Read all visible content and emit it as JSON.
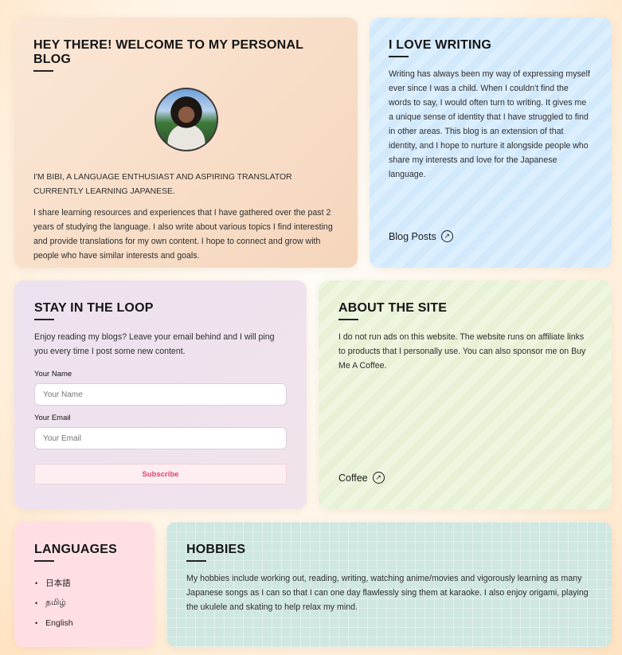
{
  "welcome": {
    "title": "Hey there! Welcome to my personal blog",
    "intro": "I'm Bibi, a language enthusiast and aspiring translator currently learning Japanese.",
    "body": "I share learning resources and experiences that I have gathered over the past 2 years of studying the language. I also write about various topics I find interesting and provide translations for my own content. I hope to connect and grow with people who have similar interests and goals."
  },
  "writing": {
    "title": "I love writing",
    "body": "Writing has always been my way of expressing myself ever since I was a child. When I couldn't find the words to say, I would often turn to writing. It gives me a unique sense of identity that I have struggled to find in other areas. This blog is an extension of that identity, and I hope to nurture it alongside people who share my interests and love for the Japanese language.",
    "link_label": "Blog Posts",
    "link_icon": "arrow-up-right-circle-icon"
  },
  "loop": {
    "title": "Stay in the loop",
    "body": "Enjoy reading my blogs? Leave your email behind and I will ping you every time I post some new content.",
    "name_label": "Your Name",
    "name_placeholder": "Your Name",
    "email_label": "Your Email",
    "email_placeholder": "Your Email",
    "subscribe_label": "Subscribe"
  },
  "about": {
    "title": "About the site",
    "body": "I do not run ads on this website. The website runs on affiliate links to products that I personally use. You can also sponsor me on Buy Me A Coffee.",
    "link_label": "Coffee",
    "link_icon": "arrow-up-right-circle-icon"
  },
  "languages": {
    "title": "Languages",
    "items": [
      "日本語",
      "தமிழ்",
      "English"
    ]
  },
  "hobbies": {
    "title": "Hobbies",
    "body": "My hobbies include working out, reading, writing, watching anime/movies and vigorously learning as many Japanese songs as I can so that I can one day flawlessly sing them at karaoke. I also enjoy origami, playing the ukulele and skating to help relax my mind."
  },
  "colors": {
    "welcome_bg": "#f8dcc6",
    "writing_bg": "#d7ecfe",
    "loop_bg": "#eee2ee",
    "about_bg": "#eaf3db",
    "languages_bg": "#ffdfe3",
    "hobbies_bg": "#cfe6e1",
    "subscribe_text": "#e0426b"
  }
}
